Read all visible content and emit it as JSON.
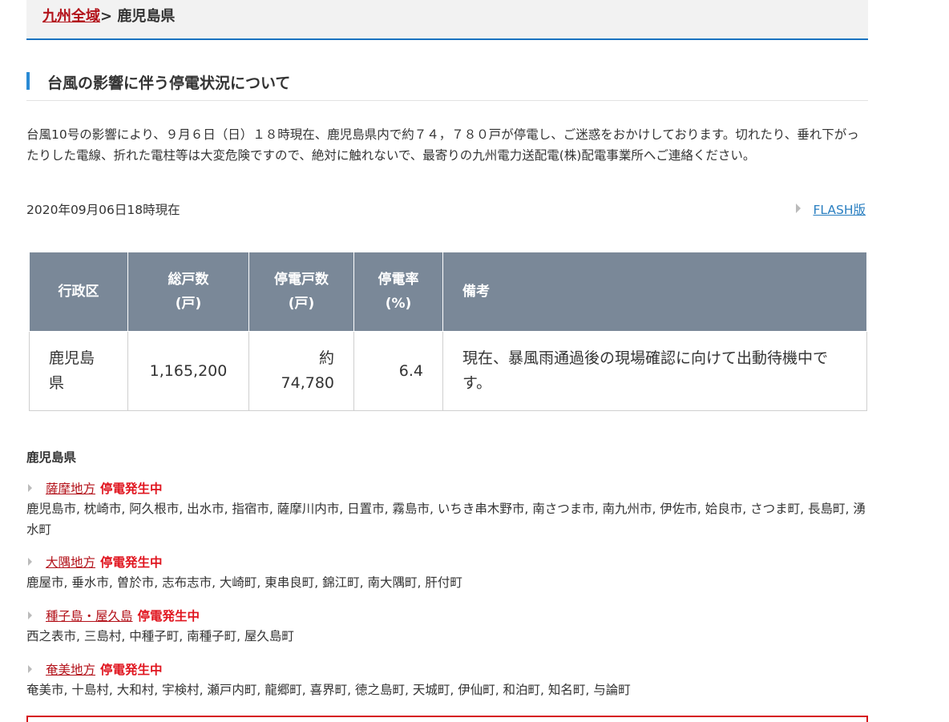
{
  "breadcrumb": {
    "link": "九州全域",
    "separator": "> ",
    "current": "鹿児島県"
  },
  "section_title": "台風の影響に伴う停電状況について",
  "notice": "台風10号の影響により、９月６日（日）１８時現在、鹿児島県内で約７４，７８０戸が停電し、ご迷惑をおかけしております。切れたり、垂れ下がったりした電線、折れた電柱等は大変危険ですので、絶対に触れないで、最寄りの九州電力送配電(株)配電事業所へご連絡ください。",
  "as_of": "2020年09月06日18時現在",
  "flash_link": "FLASH版",
  "table": {
    "headers": [
      {
        "line1": "行政区",
        "line2": ""
      },
      {
        "line1": "総戸数",
        "line2": "(戸)"
      },
      {
        "line1": "停電戸数",
        "line2": "(戸)"
      },
      {
        "line1": "停電率",
        "line2": "(%)"
      },
      {
        "line1": "備考",
        "line2": ""
      }
    ],
    "row": {
      "area": "鹿児島県",
      "total": "1,165,200",
      "outage": "約74,780",
      "rate": "6.4",
      "note": "現在、暴風雨通過後の現場確認に向けて出動待機中です。"
    }
  },
  "prefecture": "鹿児島県",
  "status_label": "停電発生中",
  "regions": [
    {
      "name": "薩摩地方",
      "cities": "鹿児島市, 枕崎市, 阿久根市, 出水市, 指宿市, 薩摩川内市, 日置市, 霧島市, いちき串木野市, 南さつま市, 南九州市, 伊佐市, 姶良市, さつま町, 長島町, 湧水町"
    },
    {
      "name": "大隅地方",
      "cities": "鹿屋市, 垂水市, 曽於市, 志布志市, 大崎町, 東串良町, 錦江町, 南大隅町, 肝付町"
    },
    {
      "name": "種子島・屋久島",
      "cities": "西之表市, 三島村, 中種子町, 南種子町, 屋久島町"
    },
    {
      "name": "奄美地方",
      "cities": "奄美市, 十島村, 大和村, 宇検村, 瀬戸内町, 龍郷町, 喜界町, 徳之島町, 天城町, 伊仙町, 和泊町, 知名町, 与論町"
    }
  ],
  "colors": {
    "header_blue": "#1a73c0",
    "link_red": "#b3121a",
    "status_red": "#e0141e",
    "table_header_bg": "#7a8898"
  }
}
